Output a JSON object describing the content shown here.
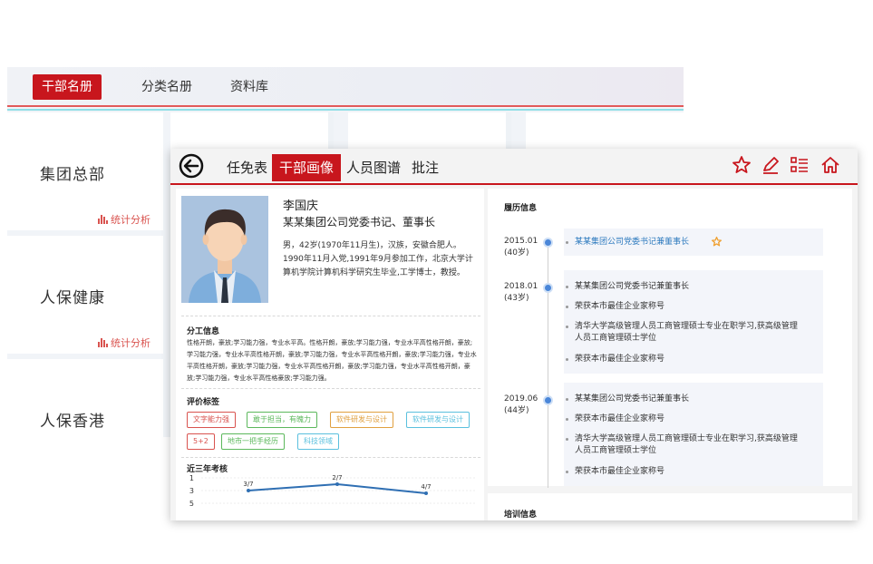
{
  "back_window": {
    "tabs": [
      "干部名册",
      "分类名册",
      "资料库"
    ],
    "cards": [
      {
        "title": "集团总部",
        "link": "统计分析"
      },
      {
        "title": "人保健康",
        "link": "统计分析"
      },
      {
        "title": "人保香港"
      }
    ]
  },
  "front_window": {
    "tabs": [
      "任免表",
      "干部画像",
      "人员图谱",
      "批注"
    ],
    "toolbar_icons": [
      "star-icon",
      "edit-icon",
      "list-icon",
      "home-icon"
    ],
    "profile": {
      "name": "李国庆",
      "position": "某某集团公司党委书记、董事长",
      "description": "男，42岁(1970年11月生)，汉族，安徽合肥人。1990年11月入党,1991年9月参加工作，北京大学计算机学院计算机科学研究生毕业,工学博士，教授。"
    },
    "division": {
      "title": "分工信息",
      "text": "性格开朗，豪放;学习能力强，专业水平高。性格开朗，豪放;学习能力强，专业水平高性格开朗，豪放;学习能力强，专业水平高性格开朗，豪放;学习能力强，专业水平高性格开朗，豪放;学习能力强，专业水平高性格开朗，豪放;学习能力强，专业水平高性格开朗，豪放;学习能力强，专业水平高性格开朗，豪放;学习能力强，专业水平高性格豪放;学习能力强。"
    },
    "tags": {
      "title": "评价标签",
      "items": [
        {
          "label": "文字能力强",
          "color": "#d9534f"
        },
        {
          "label": "敢于担当，有魄力",
          "color": "#5cb85c"
        },
        {
          "label": "软件研发与设计",
          "color": "#e0a040"
        },
        {
          "label": "软件研发与设计",
          "color": "#5bc0de"
        },
        {
          "label": "5+2",
          "color": "#d9534f"
        },
        {
          "label": "地市一把手经历",
          "color": "#5cb85c"
        },
        {
          "label": "科技领域",
          "color": "#5bc0de"
        }
      ]
    },
    "assessment": {
      "title": "近三年考核",
      "y_ticks": [
        "1",
        "3",
        "5"
      ],
      "points": [
        "3/7",
        "2/7",
        "4/7"
      ]
    },
    "resume": {
      "title": "履历信息",
      "entries": [
        {
          "date": "2015.01",
          "age": "(40岁)",
          "items": [
            "某某集团公司党委书记兼董事长"
          ]
        },
        {
          "date": "2018.01",
          "age": "(43岁)",
          "items": [
            "某某集团公司党委书记兼董事长",
            "荣获本市最佳企业家称号",
            "清华大学高级管理人员工商管理硕士专业在职学习,获高级管理人员工商管理硕士学位",
            "荣获本市最佳企业家称号"
          ]
        },
        {
          "date": "2019.06",
          "age": "(44岁)",
          "items": [
            "某某集团公司党委书记兼董事长",
            "荣获本市最佳企业家称号",
            "清华大学高级管理人员工商管理硕士专业在职学习,获高级管理人员工商管理硕士学位",
            "荣获本市最佳企业家称号"
          ]
        }
      ]
    },
    "training_title": "培训信息"
  }
}
